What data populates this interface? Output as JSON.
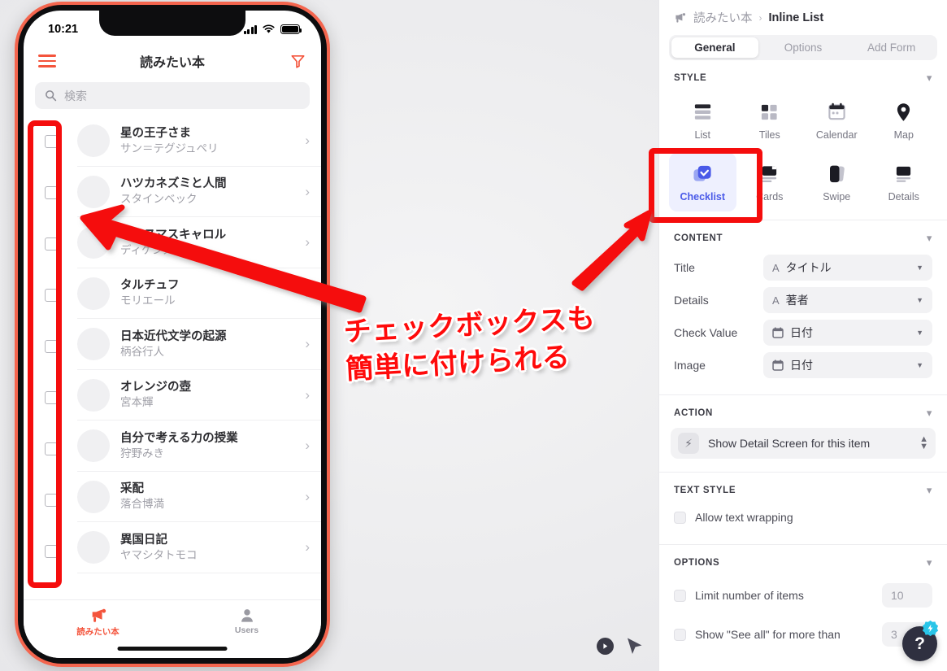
{
  "phone": {
    "status": {
      "time": "10:21",
      "signal_icon": "cellular-bars-icon",
      "wifi_icon": "wifi-icon",
      "battery_icon": "battery-icon"
    },
    "header": {
      "menu_icon": "hamburger-menu-icon",
      "title": "読みたい本",
      "filter_icon": "filter-funnel-icon"
    },
    "search": {
      "icon": "search-icon",
      "placeholder": "検索"
    },
    "books": [
      {
        "title": "星の王子さま",
        "author": "サン＝テグジュペリ"
      },
      {
        "title": "ハツカネズミと人間",
        "author": "スタインベック"
      },
      {
        "title": "クリスマスキャロル",
        "author": "ディケンズ"
      },
      {
        "title": "タルチュフ",
        "author": "モリエール"
      },
      {
        "title": "日本近代文学の起源",
        "author": "柄谷行人"
      },
      {
        "title": "オレンジの壺",
        "author": "宮本輝"
      },
      {
        "title": "自分で考える力の授業",
        "author": "狩野みき"
      },
      {
        "title": "采配",
        "author": "落合博満"
      },
      {
        "title": "異国日記",
        "author": "ヤマシタトモコ"
      }
    ],
    "tabs": [
      {
        "label": "読みたい本",
        "icon": "megaphone-icon",
        "active": true
      },
      {
        "label": "Users",
        "icon": "person-icon",
        "active": false
      }
    ]
  },
  "annotation": {
    "line1": "チェックボックスも",
    "line2": "簡単に付けられる",
    "color": "#ff0a0a"
  },
  "panel": {
    "breadcrumb": {
      "icon": "app-megaphone-icon",
      "app": "読みたい本",
      "separator": "›",
      "current": "Inline List"
    },
    "tabs": [
      {
        "label": "General",
        "selected": true
      },
      {
        "label": "Options",
        "selected": false
      },
      {
        "label": "Add Form",
        "selected": false
      }
    ],
    "style": {
      "heading": "STYLE",
      "caret_icon": "chevron-down-icon",
      "options": [
        {
          "label": "List",
          "icon": "list-icon",
          "active": false
        },
        {
          "label": "Tiles",
          "icon": "tiles-icon",
          "active": false
        },
        {
          "label": "Calendar",
          "icon": "calendar-icon",
          "active": false
        },
        {
          "label": "Map",
          "icon": "map-pin-icon",
          "active": false
        },
        {
          "label": "Checklist",
          "icon": "checkbox-checked-icon",
          "active": true
        },
        {
          "label": "Cards",
          "icon": "cards-icon",
          "active": false
        },
        {
          "label": "Swipe",
          "icon": "swipe-icon",
          "active": false
        },
        {
          "label": "Details",
          "icon": "details-icon",
          "active": false
        }
      ]
    },
    "content": {
      "heading": "CONTENT",
      "caret_icon": "chevron-down-icon",
      "fields": [
        {
          "label": "Title",
          "type_icon": "text-A-icon",
          "value": "タイトル"
        },
        {
          "label": "Details",
          "type_icon": "text-A-icon",
          "value": "著者"
        },
        {
          "label": "Check Value",
          "type_icon": "calendar-icon",
          "value": "日付"
        },
        {
          "label": "Image",
          "type_icon": "calendar-icon",
          "value": "日付"
        }
      ]
    },
    "action": {
      "heading": "ACTION",
      "caret_icon": "chevron-down-icon",
      "icon": "lightning-bolt-icon",
      "value": "Show Detail Screen for this item",
      "stepper_icon": "up-down-chevron-icon"
    },
    "text_style": {
      "heading": "TEXT STYLE",
      "caret_icon": "chevron-down-icon",
      "options": [
        {
          "label": "Allow text wrapping",
          "checked": false
        }
      ]
    },
    "options": {
      "heading": "OPTIONS",
      "caret_icon": "chevron-down-icon",
      "rows": [
        {
          "label": "Limit number of items",
          "checked": false,
          "value": "10"
        },
        {
          "label": "Show \"See all\" for more than",
          "checked": false,
          "value": "3"
        }
      ]
    }
  },
  "floating": {
    "play_icon": "play-button-icon",
    "cursor_icon": "mouse-pointer-icon",
    "help_label": "?",
    "help_badge_icon": "lightning-badge-icon"
  }
}
